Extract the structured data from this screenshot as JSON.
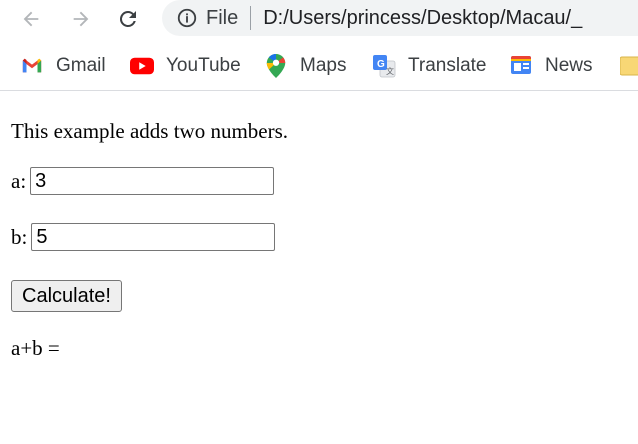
{
  "browser": {
    "address_bar": {
      "scheme_label": "File",
      "url": "D:/Users/princess/Desktop/Macau/_"
    },
    "bookmarks": [
      {
        "label": "Gmail",
        "icon": "gmail-icon"
      },
      {
        "label": "YouTube",
        "icon": "youtube-icon"
      },
      {
        "label": "Maps",
        "icon": "maps-icon"
      },
      {
        "label": "Translate",
        "icon": "translate-icon"
      },
      {
        "label": "News",
        "icon": "news-icon"
      },
      {
        "label": "",
        "icon": "folder-icon"
      }
    ]
  },
  "page": {
    "intro": "This example adds two numbers.",
    "field_a": {
      "label": "a:",
      "value": "3"
    },
    "field_b": {
      "label": "b:",
      "value": "5"
    },
    "calculate_label": "Calculate!",
    "result_label": "a+b ="
  },
  "colors": {
    "omnibox_bg": "#f1f3f4",
    "youtube_red": "#ff0000",
    "button_bg": "#efefef"
  }
}
